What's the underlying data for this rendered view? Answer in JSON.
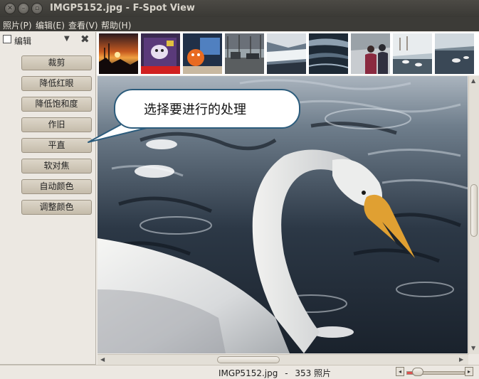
{
  "window": {
    "title": "IMGP5152.jpg - F-Spot View"
  },
  "menu": {
    "items": [
      {
        "label": "照片(P)"
      },
      {
        "label": "编辑(E)"
      },
      {
        "label": "查看(V)"
      },
      {
        "label": "帮助(H)"
      }
    ]
  },
  "sidebar": {
    "title": "编辑",
    "buttons": [
      {
        "label": "裁剪"
      },
      {
        "label": "降低红眼"
      },
      {
        "label": "降低饱和度"
      },
      {
        "label": "作旧"
      },
      {
        "label": "平直"
      },
      {
        "label": "软对焦"
      },
      {
        "label": "自动颜色"
      },
      {
        "label": "调整颜色"
      }
    ]
  },
  "filmstrip": {
    "thumbnails": [
      {
        "name": "sunset-thumb"
      },
      {
        "name": "cartoon-thumb"
      },
      {
        "name": "toy-thumb"
      },
      {
        "name": "street-thumb"
      },
      {
        "name": "snow-water-thumb"
      },
      {
        "name": "river-thumb"
      },
      {
        "name": "people-thumb"
      },
      {
        "name": "swans-bank-thumb"
      },
      {
        "name": "lake-thumb"
      }
    ]
  },
  "callout": {
    "text": "选择要进行的处理"
  },
  "statusbar": {
    "filename": "IMGP5152.jpg",
    "separator": "-",
    "count": "353 照片"
  },
  "zoom": {
    "level": 0.1
  },
  "colors": {
    "callout_border": "#2c5c7c",
    "titlebar": "#3c3b37",
    "swan_beak": "#e0a032"
  }
}
